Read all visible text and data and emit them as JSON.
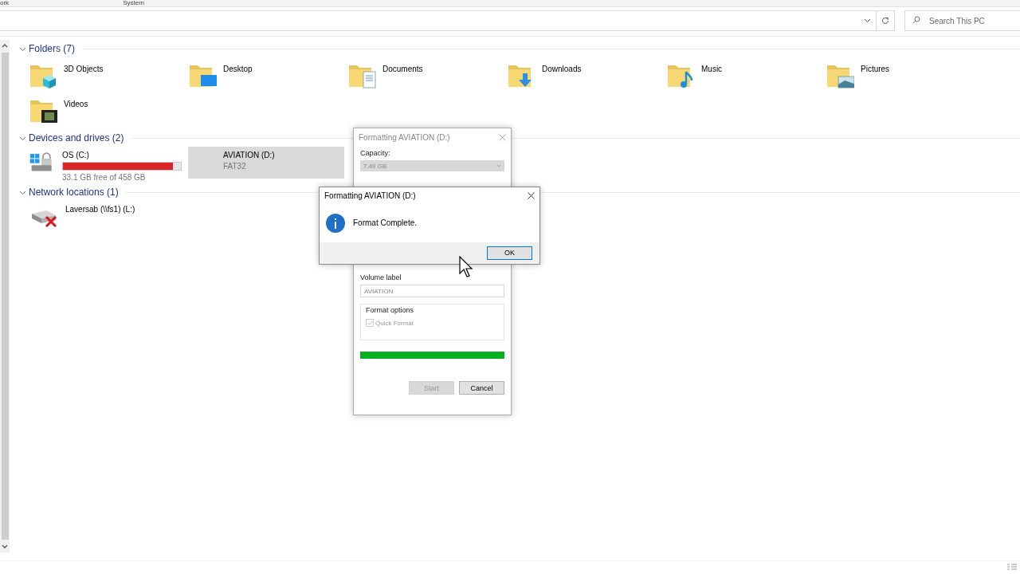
{
  "top_strip": [
    "ork",
    "System"
  ],
  "search": {
    "placeholder": "Search This PC"
  },
  "groups": [
    {
      "title": "Folders (7)",
      "expanded": true,
      "items": [
        {
          "kind": "folder",
          "name": "3D Objects"
        },
        {
          "kind": "folder",
          "name": "Desktop"
        },
        {
          "kind": "folder",
          "name": "Documents"
        },
        {
          "kind": "folder",
          "name": "Downloads"
        },
        {
          "kind": "folder",
          "name": "Music"
        },
        {
          "kind": "folder",
          "name": "Pictures"
        },
        {
          "kind": "folder",
          "name": "Videos"
        }
      ]
    },
    {
      "title": "Devices and drives (2)",
      "expanded": true,
      "items": [
        {
          "kind": "drive",
          "name": "OS (C:)",
          "level": 0.93,
          "detail": "33.1 GB free of 458 GB",
          "selected": false
        },
        {
          "kind": "removable",
          "name": "AVIATION (D:)",
          "detail": "FAT32",
          "selected": true
        }
      ]
    },
    {
      "title": "Network locations (1)",
      "expanded": true,
      "items": [
        {
          "kind": "network",
          "name": "Laversab (\\\\fs1) (L:)"
        }
      ]
    }
  ],
  "format_dialog": {
    "title": "Formatting AVIATION (D:)",
    "capacity_label": "Capacity:",
    "capacity": "7.49 GB",
    "volume_label": "Volume label",
    "volume_value": "AVIATION",
    "options_label": "Format options",
    "quick_format": {
      "label": "Quick Format",
      "checked": true,
      "disabled": true
    },
    "progress": {
      "level": 1
    },
    "buttons": [
      {
        "label": "Start",
        "disabled": true
      },
      {
        "label": "Cancel",
        "disabled": false
      }
    ]
  },
  "message_box": {
    "title": "Formatting AVIATION (D:)",
    "message": "Format Complete.",
    "button": "OK"
  }
}
